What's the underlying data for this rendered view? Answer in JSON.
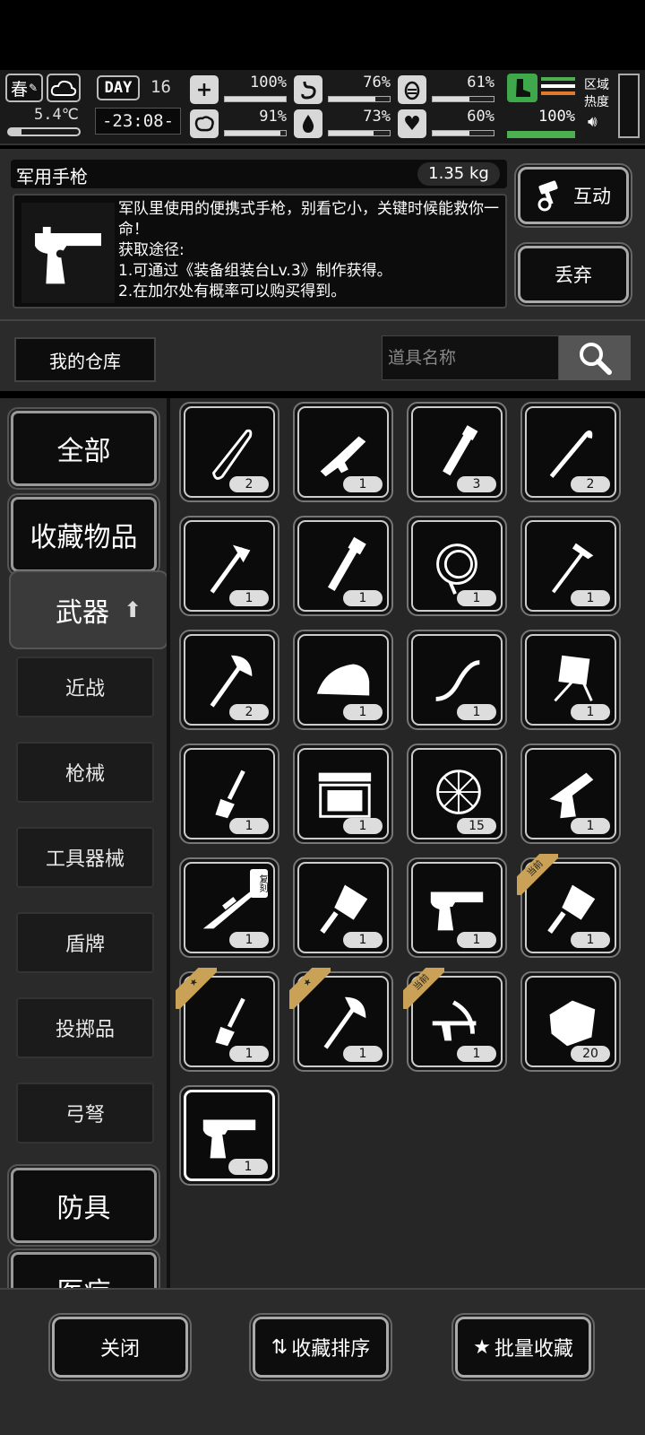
{
  "status": {
    "season": "春",
    "temperature": "5.4℃",
    "day_label": "DAY",
    "day_number": "16",
    "time": "-23:08-",
    "stats": [
      {
        "icon": "medkit-icon",
        "value": "100%",
        "level": 1.0
      },
      {
        "icon": "stomach-icon",
        "value": "76%",
        "level": 0.76
      },
      {
        "icon": "bladder-icon",
        "value": "61%",
        "level": 0.61
      },
      {
        "icon": "brain-icon",
        "value": "91%",
        "level": 0.91
      },
      {
        "icon": "water-drop-icon",
        "value": "73%",
        "level": 0.73
      },
      {
        "icon": "heart-icon",
        "value": "60%",
        "level": 0.6
      }
    ],
    "stamina": {
      "value": "100%",
      "level": 1.0
    },
    "zone_heat": "区域热度"
  },
  "item": {
    "name": "军用手枪",
    "weight": "1.35 kg",
    "description": "军队里使用的便携式手枪，别看它小，关键时候能救你一命！",
    "source_title": "获取途径:",
    "source_1": "1.可通过《装备组装台Lv.3》制作获得。",
    "source_2": "2.在加尔处有概率可以购买得到。",
    "interact_label": "互动",
    "discard_label": "丢弃"
  },
  "warehouse": {
    "label": "我的仓库",
    "search_placeholder": "道具名称"
  },
  "categories": {
    "all": "全部",
    "favorites": "收藏物品",
    "weapons": "武器",
    "melee": "近战",
    "firearms": "枪械",
    "tools": "工具器械",
    "shields": "盾牌",
    "throwables": "投掷品",
    "bows": "弓弩",
    "armor": "防具",
    "medical": "医疗"
  },
  "items": [
    {
      "icon": "knife-icon",
      "count": "2"
    },
    {
      "icon": "submachine-gun-icon",
      "count": "1"
    },
    {
      "icon": "wrench-pipe-icon",
      "count": "3"
    },
    {
      "icon": "crowbar-icon",
      "count": "2"
    },
    {
      "icon": "fire-axe-icon",
      "count": "1"
    },
    {
      "icon": "pipe-wrench-icon",
      "count": "1"
    },
    {
      "icon": "rope-icon",
      "count": "1"
    },
    {
      "icon": "hammer-icon",
      "count": "1"
    },
    {
      "icon": "axe-icon",
      "count": "2"
    },
    {
      "icon": "iron-icon",
      "count": "1"
    },
    {
      "icon": "bow-icon",
      "count": "1"
    },
    {
      "icon": "folding-chair-icon",
      "count": "1"
    },
    {
      "icon": "chisel-icon",
      "count": "1"
    },
    {
      "icon": "ammo-crate-icon",
      "count": "1"
    },
    {
      "icon": "net-icon",
      "count": "15"
    },
    {
      "icon": "revolver-icon",
      "count": "1"
    },
    {
      "icon": "sniper-rifle-icon",
      "count": "1",
      "tag": "复刻"
    },
    {
      "icon": "cleaver-icon",
      "count": "1"
    },
    {
      "icon": "pistol-icon",
      "count": "1"
    },
    {
      "icon": "cleaver-icon",
      "count": "1",
      "badge": "当前"
    },
    {
      "icon": "chisel-icon",
      "count": "1",
      "badge": "★"
    },
    {
      "icon": "axe-icon",
      "count": "1",
      "badge": "★"
    },
    {
      "icon": "crossbow-icon",
      "count": "1",
      "badge": "当前"
    },
    {
      "icon": "rock-icon",
      "count": "20"
    },
    {
      "icon": "pistol-icon",
      "count": "1",
      "selected": true
    }
  ],
  "bottom": {
    "close_label": "关闭",
    "sort_label": "收藏排序",
    "batch_label": "批量收藏"
  }
}
